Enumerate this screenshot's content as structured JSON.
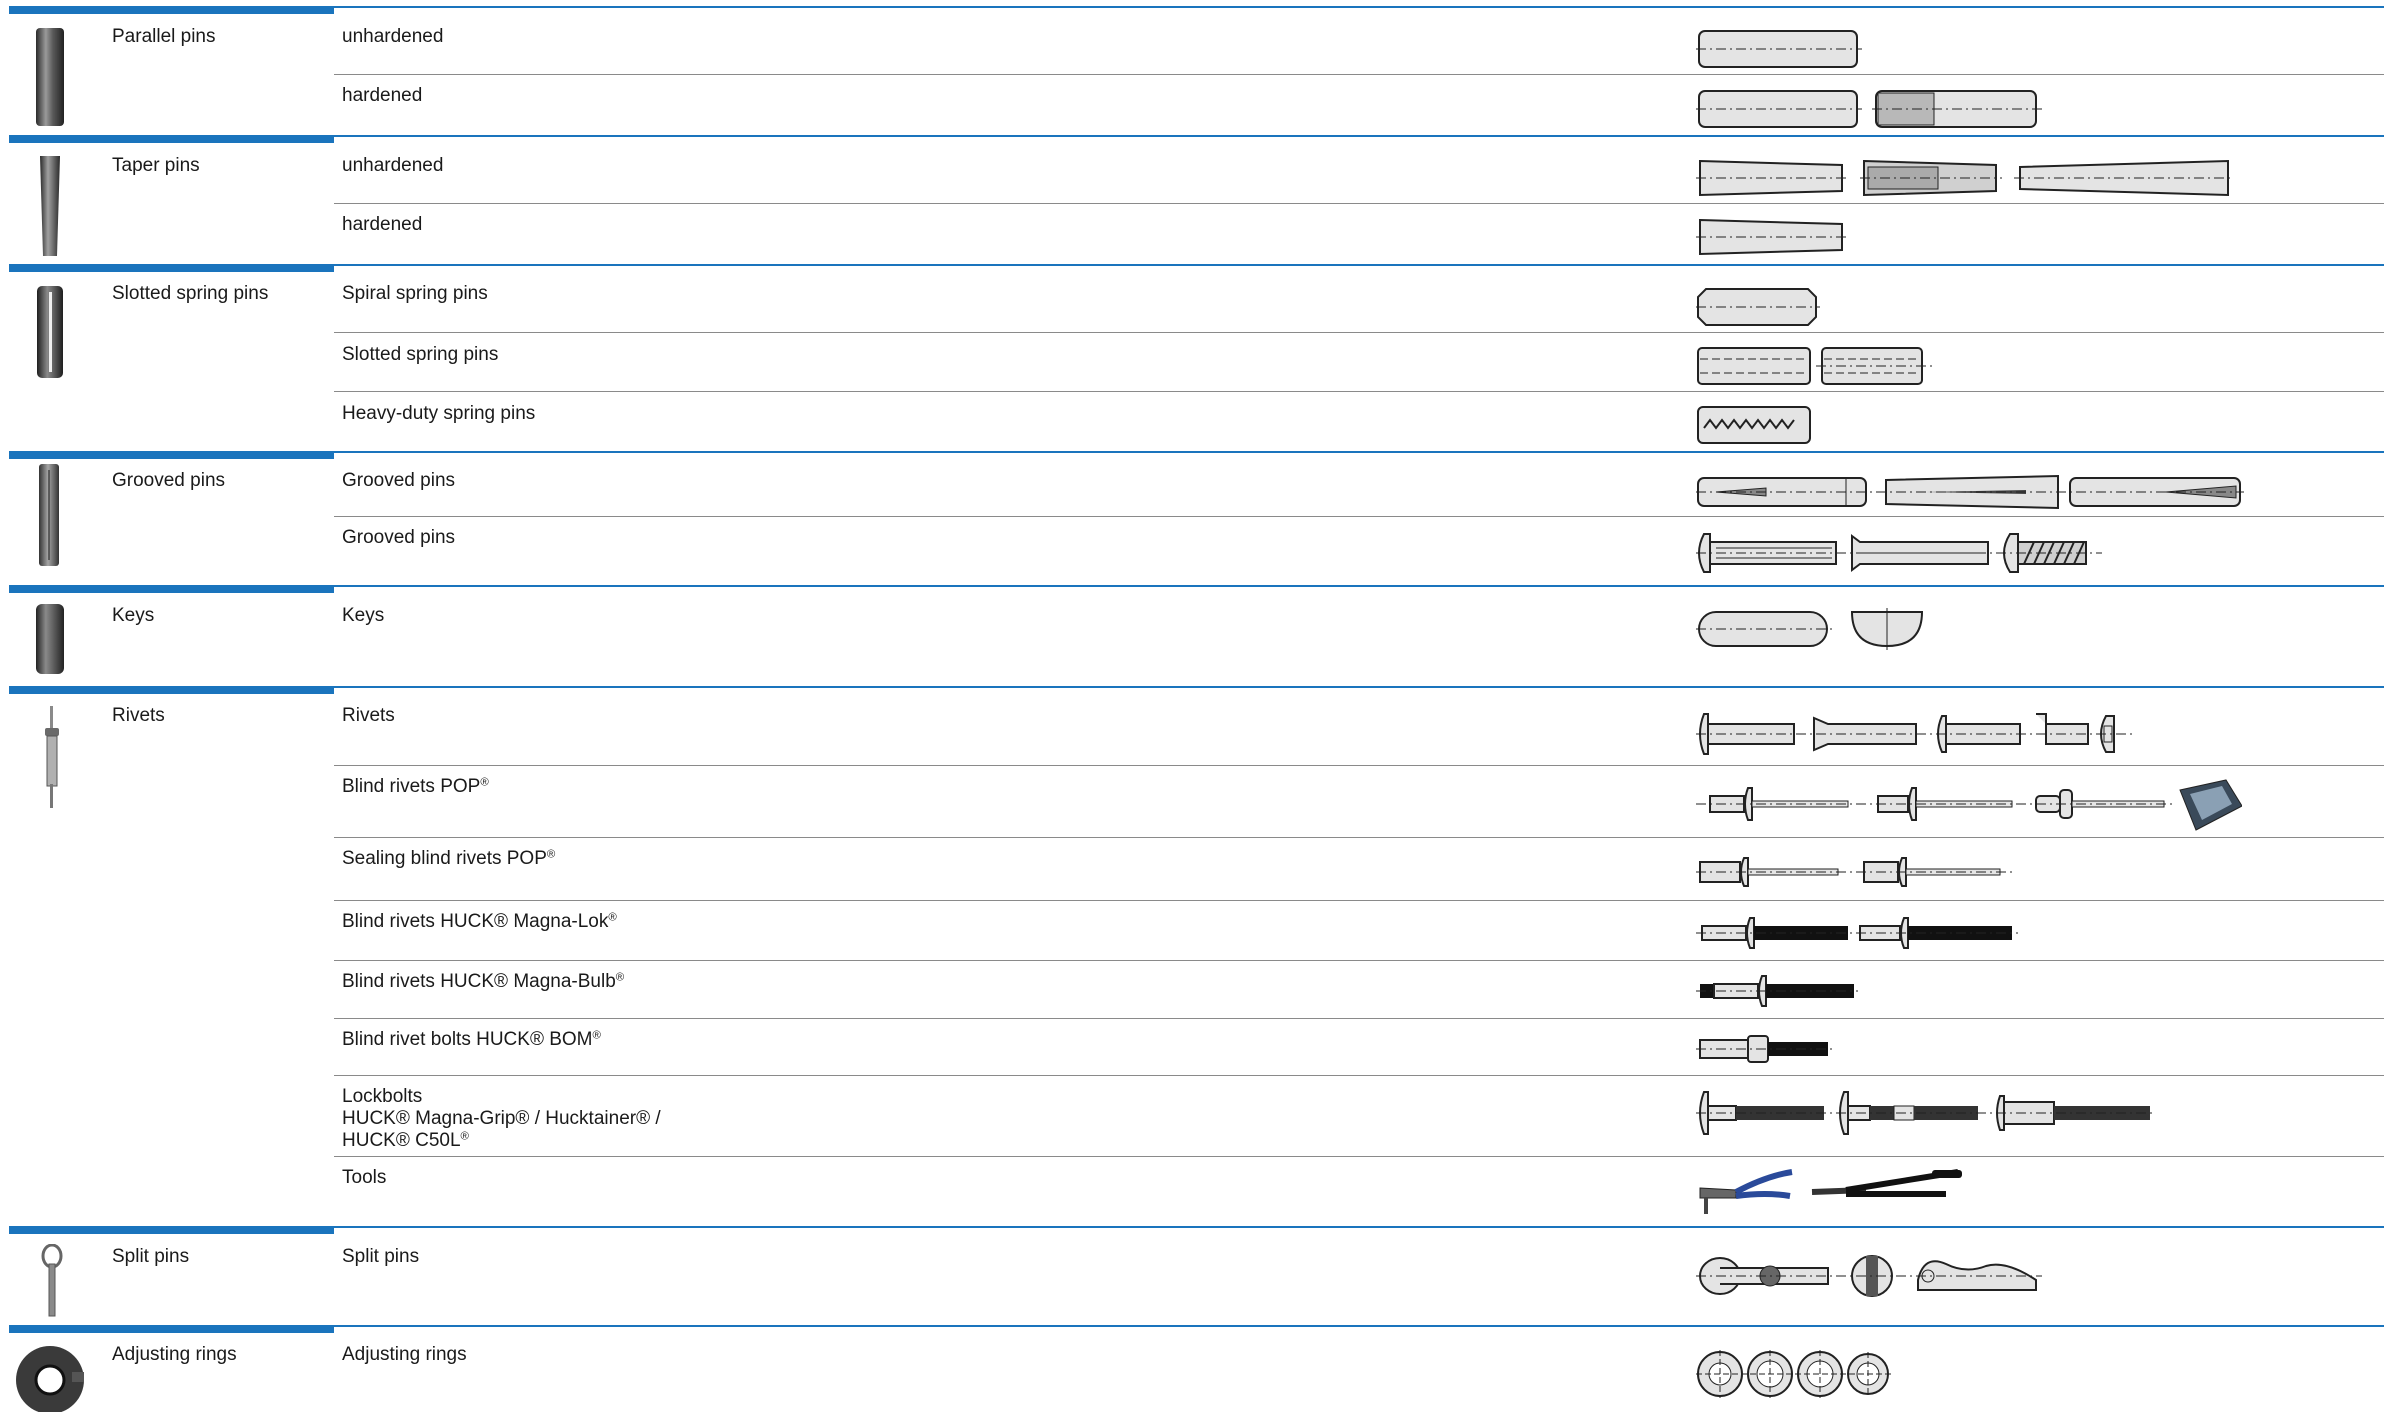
{
  "accent_color": "#1a74bd",
  "categories": [
    {
      "name": "Parallel pins",
      "icon": "parallel-pin-photo-icon",
      "subs": [
        {
          "label": "unhardened"
        },
        {
          "label": "hardened"
        }
      ]
    },
    {
      "name": "Taper pins",
      "icon": "taper-pin-photo-icon",
      "subs": [
        {
          "label": "unhardened"
        },
        {
          "label": "hardened"
        }
      ]
    },
    {
      "name": "Slotted spring pins",
      "icon": "slotted-spring-pin-photo-icon",
      "subs": [
        {
          "label": "Spiral spring pins"
        },
        {
          "label": "Slotted spring pins"
        },
        {
          "label": "Heavy-duty spring pins"
        }
      ]
    },
    {
      "name": "Grooved pins",
      "icon": "grooved-pin-photo-icon",
      "subs": [
        {
          "label": "Grooved pins"
        },
        {
          "label": "Grooved pins"
        }
      ]
    },
    {
      "name": "Keys",
      "icon": "key-photo-icon",
      "subs": [
        {
          "label": "Keys"
        }
      ]
    },
    {
      "name": "Rivets",
      "icon": "rivet-photo-icon",
      "subs": [
        {
          "label": "Rivets"
        },
        {
          "label": "Blind rivets POP",
          "sup": "®"
        },
        {
          "label": "Sealing blind rivets POP",
          "sup": "®"
        },
        {
          "label": "Blind rivets HUCK® Magna-Lok",
          "sup": "®"
        },
        {
          "label": "Blind rivets HUCK® Magna-Bulb",
          "sup": "®"
        },
        {
          "label": "Blind rivet bolts HUCK® BOM",
          "sup": "®"
        },
        {
          "label": "Lockbolts\nHUCK® Magna-Grip® / Hucktainer® /\nHUCK® C50L",
          "sup": "®"
        },
        {
          "label": "Tools"
        }
      ]
    },
    {
      "name": "Split pins",
      "icon": "split-pin-photo-icon",
      "subs": [
        {
          "label": "Split pins"
        }
      ]
    },
    {
      "name": "Adjusting rings",
      "icon": "adjusting-ring-photo-icon",
      "subs": [
        {
          "label": "Adjusting rings"
        }
      ]
    }
  ]
}
